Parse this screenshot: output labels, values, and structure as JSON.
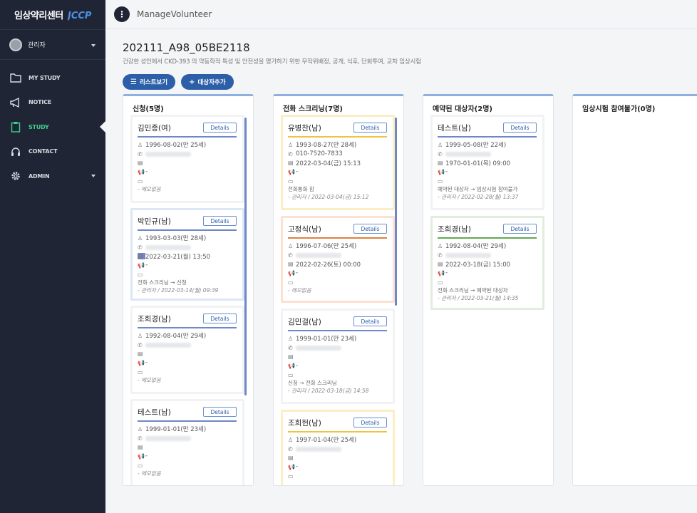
{
  "brand": {
    "title": "임상약리센터",
    "logo_text": "JCCP"
  },
  "user": {
    "name": "관리자"
  },
  "nav": [
    {
      "label": "MY STUDY",
      "icon": "folder-icon"
    },
    {
      "label": "NOTICE",
      "icon": "megaphone-icon"
    },
    {
      "label": "STUDY",
      "icon": "clipboard-icon",
      "active": true
    },
    {
      "label": "CONTACT",
      "icon": "headset-icon"
    },
    {
      "label": "ADMIN",
      "icon": "gear-icon"
    }
  ],
  "topbar": {
    "menu_icon": "⋮",
    "breadcrumb": "ManageVolunteer"
  },
  "study": {
    "title": "202111_A98_05BE2118",
    "description": "건강한 성인에서 CKD-393 의 약동학적 특성 및 안전성을 평가하기 위한 무작위배정, 공개, 식후, 단회투여, 교차 임상시험"
  },
  "buttons": {
    "list_view": "리스트보기",
    "add_subject": "대상자추가"
  },
  "columns": [
    {
      "title": "신청(5명)",
      "cards": [
        {
          "name": "김민종(여)",
          "birth": "1996-08-02(만 25세)",
          "date": "",
          "megaphone": "-",
          "memo": "",
          "note": "- 메모없음",
          "style": ""
        },
        {
          "name": "박민규(남)",
          "birth": "1993-03-03(만 28세)",
          "date": "2022-03-21(월) 13:50",
          "megaphone": "-",
          "memo": "전화 스크리닝 → 신청",
          "note": "- 관리자 / 2022-03-14(월) 09:39",
          "style": "sel-blue"
        },
        {
          "name": "조희경(남)",
          "birth": "1992-08-04(만 29세)",
          "date": "",
          "megaphone": "-",
          "memo": "",
          "note": "- 메모없음",
          "style": ""
        },
        {
          "name": "테스트(남)",
          "birth": "1999-01-01(만 23세)",
          "date": "",
          "megaphone": "-",
          "memo": "",
          "note": "- 메모없음",
          "style": ""
        }
      ]
    },
    {
      "title": "전화 스크리닝(7명)",
      "cards": [
        {
          "name": "유병찬(남)",
          "birth": "1993-08-27(만 28세)",
          "phone": "010-7520-7833",
          "date": "2022-03-04(금) 15:13",
          "megaphone": "-",
          "memo": "전화통화 함",
          "note": "- 관리자 / 2022-03-04(금) 15:12",
          "style": "yellow"
        },
        {
          "name": "고정식(남)",
          "birth": "1996-07-06(만 25세)",
          "date": "2022-02-26(토) 00:00",
          "megaphone": "-",
          "memo": "",
          "note": "- 메모없음",
          "style": "orange"
        },
        {
          "name": "김민걸(남)",
          "birth": "1999-01-01(만 23세)",
          "date": "",
          "megaphone": "-",
          "memo": "신청 → 전화 스크리닝",
          "note": "- 관리자 / 2022-03-18(금) 14:58",
          "style": ""
        },
        {
          "name": "조희헌(남)",
          "birth": "1997-01-04(만 25세)",
          "date": "",
          "megaphone": "-",
          "memo": "",
          "note": "",
          "style": "yellow"
        }
      ]
    },
    {
      "title": "예약된 대상자(2명)",
      "cards": [
        {
          "name": "테스트(남)",
          "birth": "1999-05-08(만 22세)",
          "date": "1970-01-01(목) 09:00",
          "megaphone": "-",
          "memo": "예약된 대상자 → 임상시험 참여불가",
          "note": "- 관리자 / 2022-02-28(월) 13:37",
          "style": ""
        },
        {
          "name": "조희경(남)",
          "birth": "1992-08-04(만 29세)",
          "date": "2022-03-18(금) 15:00",
          "megaphone": "-",
          "memo": "전화 스크리닝 → 예약된 대상자",
          "note": "- 관리자 / 2022-03-21(월) 14:35",
          "style": "green"
        }
      ]
    },
    {
      "title": "임상시험 참여불가(0명)",
      "cards": []
    }
  ],
  "details_label": "Details"
}
